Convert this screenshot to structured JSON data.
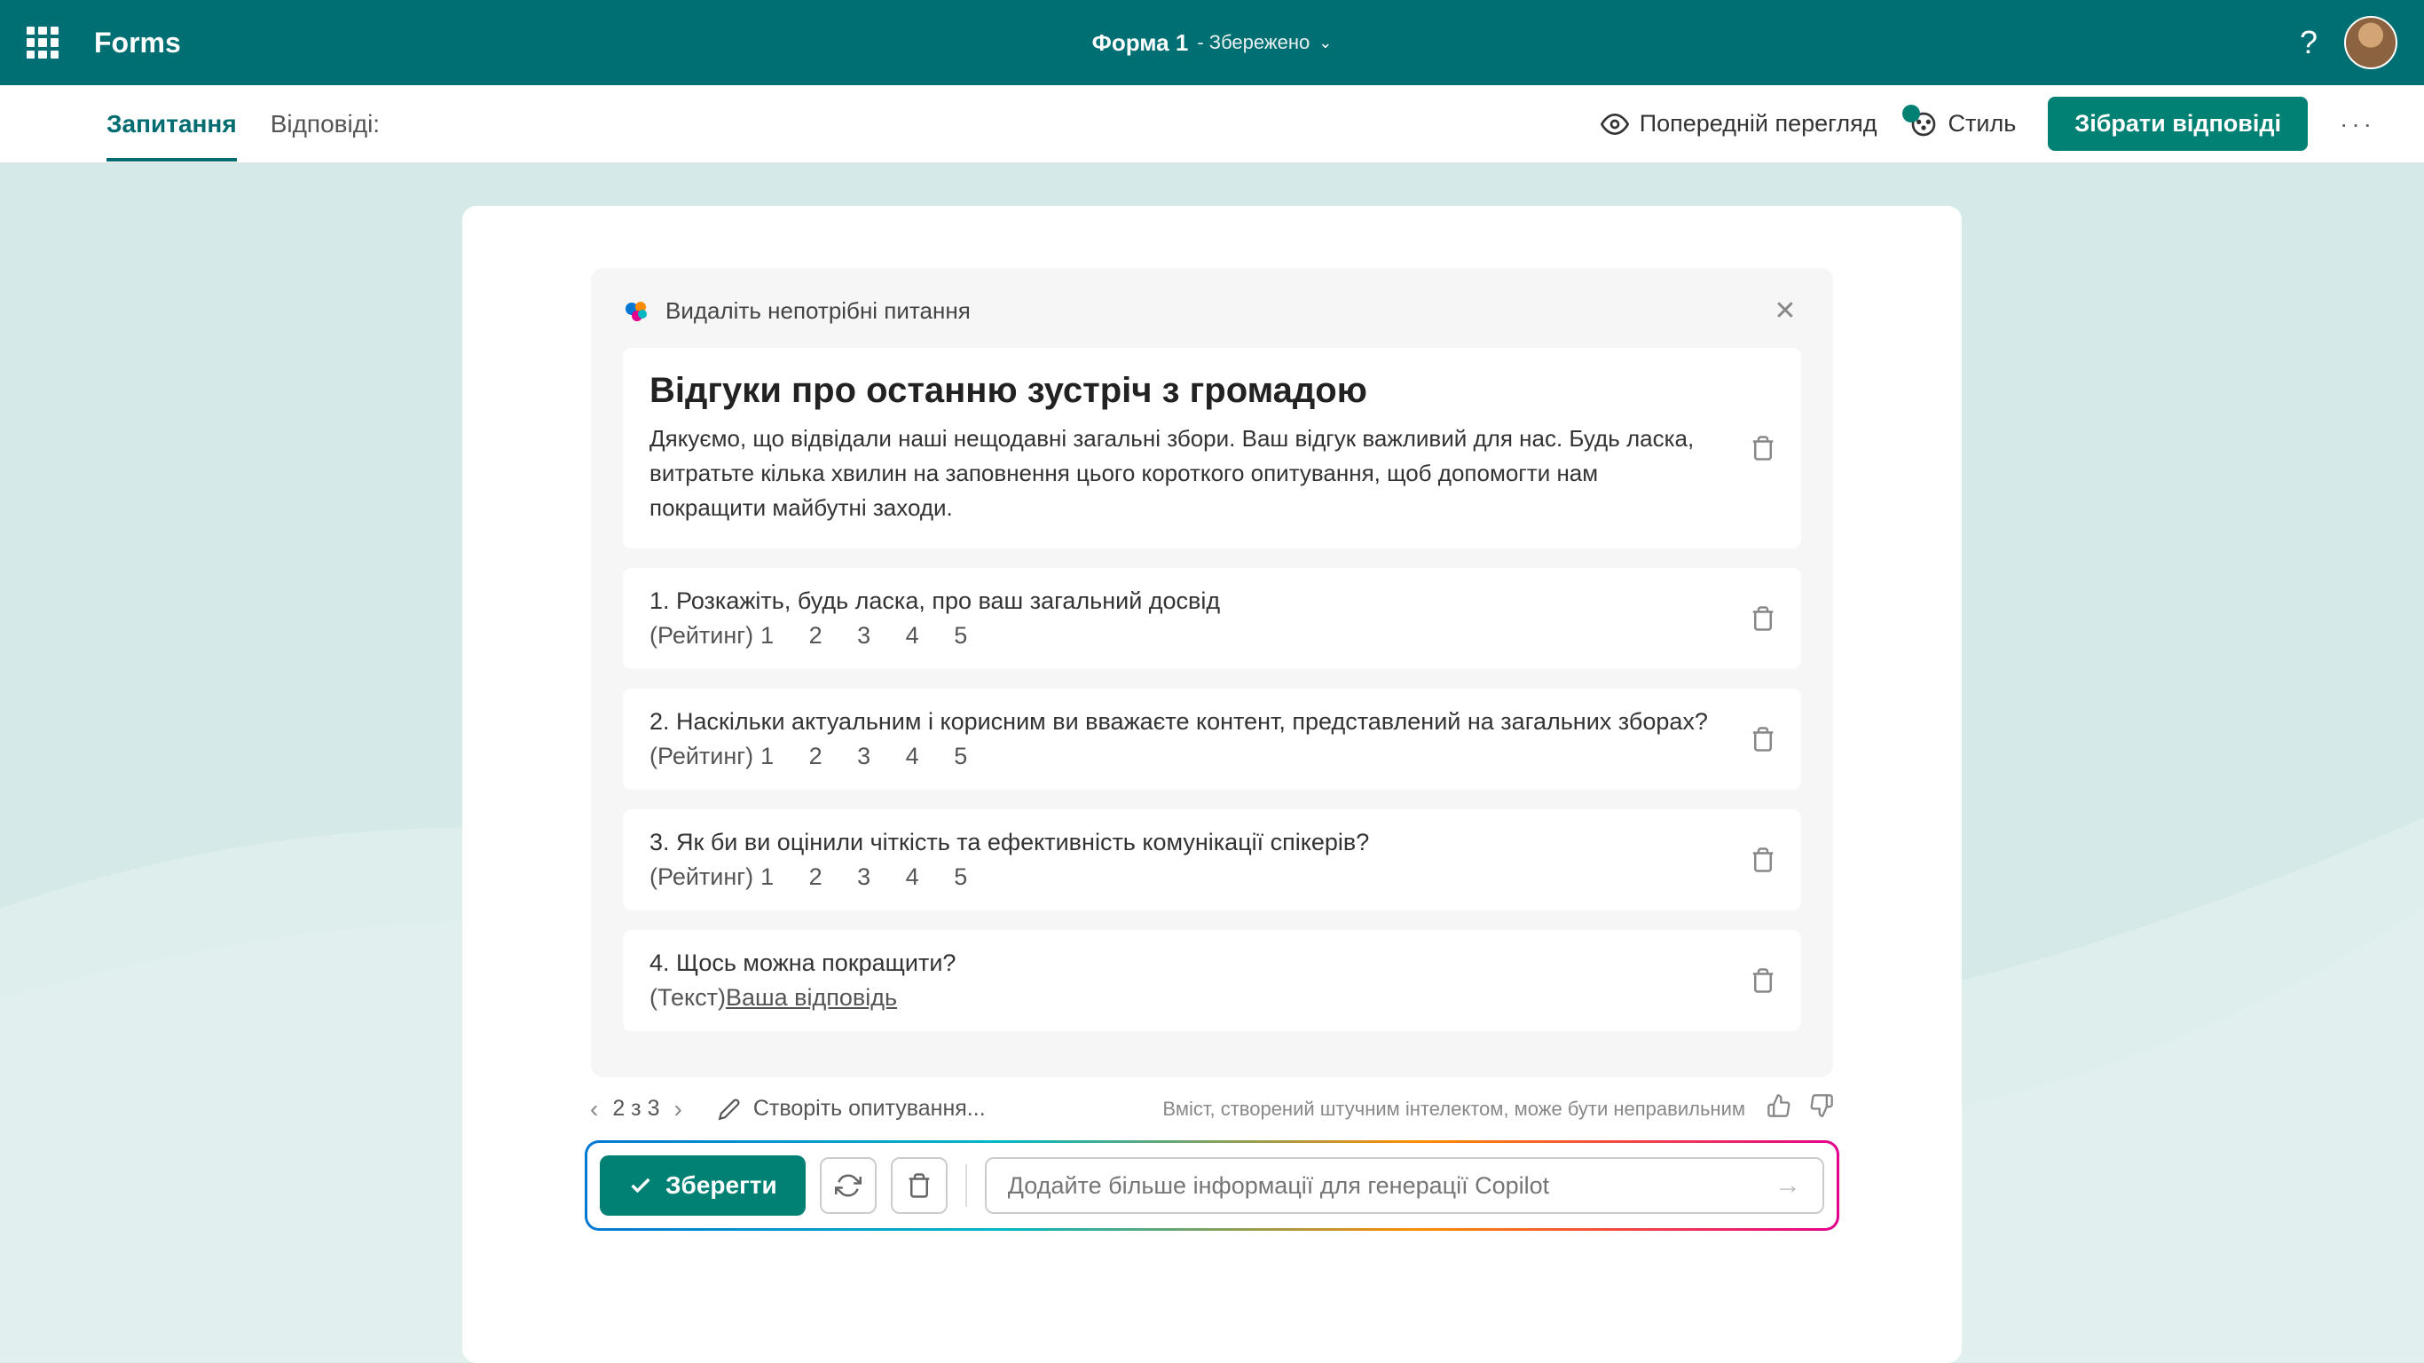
{
  "header": {
    "app": "Forms",
    "formTitle": "Форма 1",
    "saved": "- Збережено"
  },
  "toolbar": {
    "tabs": {
      "questions": "Запитання",
      "responses": "Відповіді:"
    },
    "preview": "Попередній перегляд",
    "style": "Стиль",
    "collect": "Зібрати відповіді"
  },
  "copilot": {
    "headText": "Видаліть непотрібні питання",
    "formTitle": "Відгуки про останню зустріч з громадою",
    "formDesc": "Дякуємо, що відвідали наші нещодавні загальні збори. Ваш відгук важливий для нас. Будь ласка, витратьте кілька хвилин на заповнення цього короткого опитування, щоб допомогти нам покращити майбутні заходи.",
    "questions": [
      {
        "text": "1. Розкажіть, будь ласка, про ваш загальний досвід",
        "type": "(Рейтинг)",
        "scale": "1   2   3   4   5"
      },
      {
        "text": "2. Наскільки актуальним і корисним ви вважаєте контент, представлений на загальних зборах?",
        "type": "(Рейтинг)",
        "scale": "1   2   3   4   5"
      },
      {
        "text": "3. Як би ви оцінили чіткість та ефективність комунікації спікерів?",
        "type": "(Рейтинг)",
        "scale": "1   2   3   4   5"
      },
      {
        "text": "4. Щось можна покращити?",
        "type": "(Текст)",
        "answer": "Ваша відповідь"
      }
    ]
  },
  "pager": {
    "count": "2 з 3",
    "create": "Створіть опитування..."
  },
  "disclaimer": "Вміст, створений штучним інтелектом, може бути неправильним",
  "actions": {
    "save": "Зберегти",
    "placeholder": "Додайте більше інформації для генерації Copilot"
  }
}
